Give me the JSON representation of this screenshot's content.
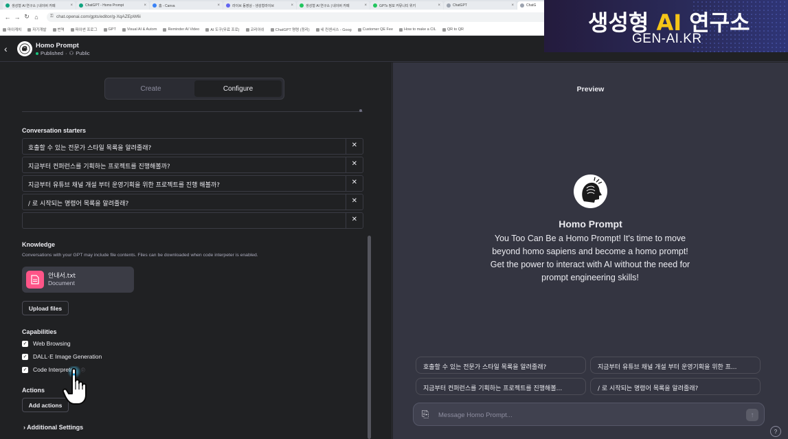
{
  "browser": {
    "tabs": [
      {
        "label": "생성형 AI 연구소 | 네이버 카페",
        "active": false
      },
      {
        "label": "ChatGPT - Homo Prompt",
        "active": false
      },
      {
        "label": "홈 - Canva",
        "active": false
      },
      {
        "label": "라이브 동영상 - 생성형라이브",
        "active": false
      },
      {
        "label": "생성형 AI 연구소 | 네이버 카페",
        "active": false
      },
      {
        "label": "GPTs 정보 커뮤니티 위키",
        "active": false
      },
      {
        "label": "ChatGPT",
        "active": false
      },
      {
        "label": "ChatG",
        "active": true
      }
    ],
    "url": "chat.openai.com/gpts/editor/g-XqAZEpW6i",
    "bookmarks": [
      "마이캐치",
      "자기개발",
      "번역",
      "파이썬 프로그",
      "GPT",
      "Visual AI & Autom",
      "Reminder AI Video",
      "AI 도구(무료 프로)",
      "코리아쉬",
      "ChatGPT 명령 (정리)",
      "네 컨센서스 - Goog",
      "Customer QE Fee",
      "How to make a CIL",
      "QR to QR"
    ]
  },
  "brand": {
    "title_prefix": "생성형 ",
    "title_ai": "AI",
    "title_suffix": " 연구소",
    "url": "GEN-AI.KR"
  },
  "header": {
    "gpt_name": "Homo Prompt",
    "status": "Published",
    "separator": "·",
    "visibility_icon": "people-icon",
    "visibility": "Public"
  },
  "tabs": {
    "create": "Create",
    "configure": "Configure",
    "active": "configure"
  },
  "starters": {
    "title": "Conversation starters",
    "items": [
      "호출할 수 있는 전문가 스타일 목록을 알려줄래?",
      "지금부터 컨퍼런스를 기획하는 프로젝트를 진행해볼까?",
      "지금부터 유튜브 채널 개설 부터 운영기획을 위한 프로젝트를 진행 해볼까?",
      "/ 로 시작되는 명령어 목록을 알려줄래?",
      ""
    ],
    "remove_glyph": "✕"
  },
  "knowledge": {
    "title": "Knowledge",
    "description": "Conversations with your GPT may include file contents. Files can be downloaded when code interpeter is enabled.",
    "file_name": "안내서.txt",
    "file_type": "Document",
    "upload_label": "Upload files"
  },
  "capabilities": {
    "title": "Capabilities",
    "items": [
      {
        "label": "Web Browsing",
        "checked": true
      },
      {
        "label": "DALL·E Image Generation",
        "checked": true
      },
      {
        "label": "Code Interpreter",
        "checked": true
      }
    ],
    "check_glyph": "✓"
  },
  "actions": {
    "title": "Actions",
    "add_label": "Add actions"
  },
  "additional": {
    "chevron": "›",
    "label": "Additional Settings"
  },
  "preview": {
    "title": "Preview",
    "name": "Homo Prompt",
    "description": "You Too Can Be a Homo Prompt! It's time to move beyond homo sapiens and become a homo prompt! Get the power to interact with AI without the need for prompt engineering skills!",
    "suggestions": [
      "호출할 수 있는 전문가 스타일 목록을 알려줄래?",
      "지금부터 유튜브 채널 개설 부터 운영기획을 위한 프...",
      "지금부터 컨퍼런스를 기획하는 프로젝트를 진행해볼...",
      "/ 로 시작되는 명령어 목록을 알려줄래?"
    ],
    "composer_placeholder": "Message Homo Prompt...",
    "send_glyph": "↑",
    "help_glyph": "?"
  },
  "colors": {
    "accent": "#19c37d",
    "file_icon": "#ff5588",
    "brand_ai": "#f5c518"
  }
}
